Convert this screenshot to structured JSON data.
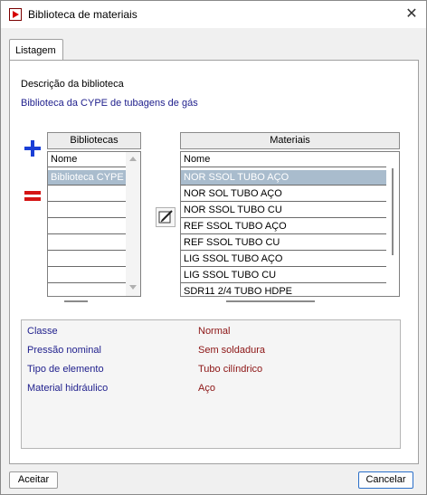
{
  "window": {
    "title": "Biblioteca de materiais",
    "close_glyph": "✕"
  },
  "tabs": [
    {
      "label": "Listagem"
    }
  ],
  "library": {
    "description_label": "Descrição da biblioteca",
    "description_value": "Biblioteca da CYPE de tubagens de gás"
  },
  "libraries_grid": {
    "header": "Bibliotecas",
    "column": "Nome",
    "rows": [
      "Biblioteca CYPE",
      "",
      "",
      "",
      "",
      "",
      "",
      ""
    ],
    "selected_index": 0
  },
  "materials_grid": {
    "header": "Materiais",
    "column": "Nome",
    "rows": [
      "NOR SSOL TUBO AÇO",
      "NOR SOL TUBO AÇO",
      "NOR SSOL TUBO CU",
      "REF SSOL TUBO AÇO",
      "REF SSOL TUBO CU",
      "LIG SSOL TUBO AÇO",
      "LIG SSOL TUBO CU",
      "SDR11 2/4 TUBO HDPE"
    ],
    "selected_index": 0
  },
  "icons": {
    "add": "plus-icon",
    "remove": "remove-icon",
    "edit": "edit-icon",
    "add_color": "#1a3fd6",
    "remove_color": "#d41414"
  },
  "properties": [
    {
      "label": "Classe",
      "value": "Normal"
    },
    {
      "label": "Pressão nominal",
      "value": "Sem soldadura"
    },
    {
      "label": "Tipo de elemento",
      "value": "Tubo cilíndrico"
    },
    {
      "label": "Material hidráulico",
      "value": "Aço"
    }
  ],
  "buttons": {
    "accept": "Aceitar",
    "cancel": "Cancelar"
  }
}
